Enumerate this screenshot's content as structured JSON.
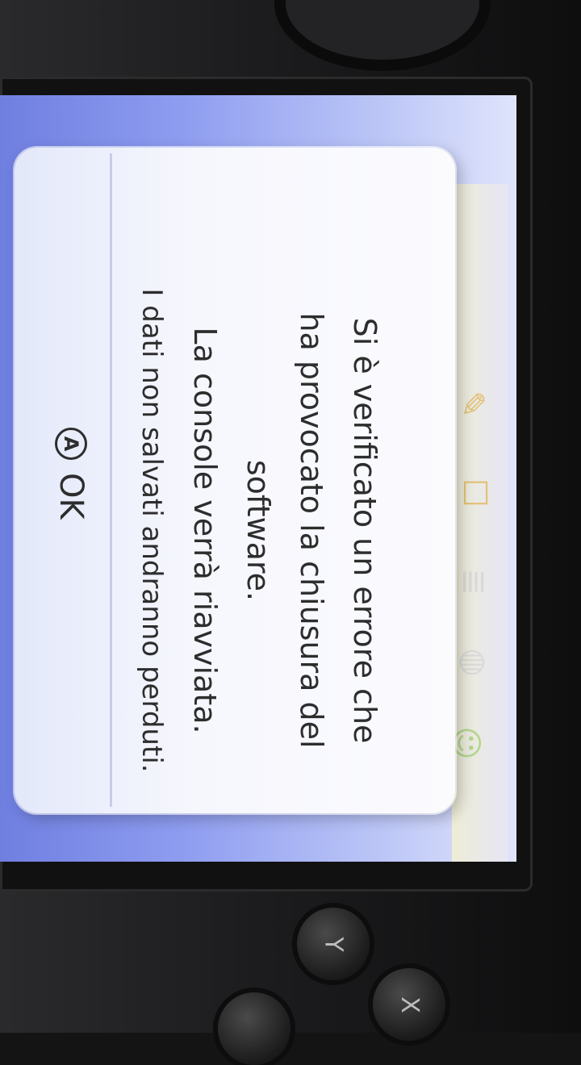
{
  "dialog": {
    "lines": [
      "Si è verificato un errore che",
      "ha provocato la chiusura del",
      "software.",
      "La console verrà riavviata.",
      "I dati non salvati andranno perduti."
    ],
    "button_icon_letter": "A",
    "button_label": "OK"
  },
  "device_buttons": {
    "y_label": "Y",
    "x_label": "X"
  },
  "icons": [
    "pencil-icon",
    "message-icon",
    "notes-icon",
    "globe-icon",
    "friends-icon",
    "download-arrow-icon"
  ],
  "colors": {
    "screen_bg": "#8e9cf0",
    "dialog_bg": "#f6f7fd",
    "text": "#2d2d2d"
  }
}
